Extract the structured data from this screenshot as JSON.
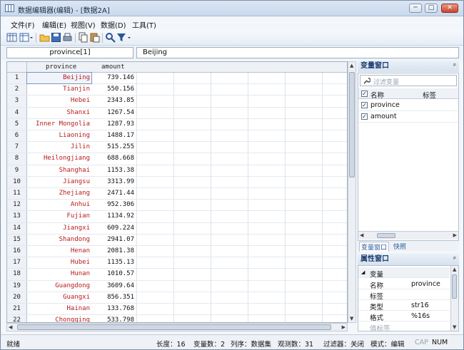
{
  "window": {
    "title": "数据编辑器(编辑) - [数据2A]",
    "min": "─",
    "max": "□",
    "close": "✕"
  },
  "menu": [
    "文件(F)",
    "编辑(E)",
    "视图(V)",
    "数据(D)",
    "工具(T)"
  ],
  "varbar": {
    "name": "province[1]",
    "value": "Beijing"
  },
  "grid": {
    "headers": [
      "province",
      "amount"
    ],
    "rows": [
      {
        "n": "1",
        "province": "Beijing",
        "amount": "739.146"
      },
      {
        "n": "2",
        "province": "Tianjin",
        "amount": "550.156"
      },
      {
        "n": "3",
        "province": "Hebei",
        "amount": "2343.85"
      },
      {
        "n": "4",
        "province": "Shanxi",
        "amount": "1267.54"
      },
      {
        "n": "5",
        "province": "Inner Mongolia",
        "amount": "1287.93"
      },
      {
        "n": "6",
        "province": "Liaoning",
        "amount": "1488.17"
      },
      {
        "n": "7",
        "province": "Jilin",
        "amount": "515.255"
      },
      {
        "n": "8",
        "province": "Heilongjiang",
        "amount": "688.668"
      },
      {
        "n": "9",
        "province": "Shanghai",
        "amount": "1153.38"
      },
      {
        "n": "10",
        "province": "Jiangsu",
        "amount": "3313.99"
      },
      {
        "n": "11",
        "province": "Zhejiang",
        "amount": "2471.44"
      },
      {
        "n": "12",
        "province": "Anhui",
        "amount": "952.306"
      },
      {
        "n": "13",
        "province": "Fujian",
        "amount": "1134.92"
      },
      {
        "n": "14",
        "province": "Jiangxi",
        "amount": "609.224"
      },
      {
        "n": "15",
        "province": "Shandong",
        "amount": "2941.07"
      },
      {
        "n": "16",
        "province": "Henan",
        "amount": "2081.38"
      },
      {
        "n": "17",
        "province": "Hubei",
        "amount": "1135.13"
      },
      {
        "n": "18",
        "province": "Hunan",
        "amount": "1010.57"
      },
      {
        "n": "19",
        "province": "Guangdong",
        "amount": "3609.64"
      },
      {
        "n": "20",
        "province": "Guangxi",
        "amount": "856.351"
      },
      {
        "n": "21",
        "province": "Hainan",
        "amount": "133.768"
      },
      {
        "n": "22",
        "province": "Chongqing",
        "amount": "533.798"
      }
    ]
  },
  "varwin": {
    "title": "变量窗口",
    "pin": "ᵖ",
    "filter_placeholder": "过滤变量",
    "col_name": "名称",
    "col_label": "标签",
    "vars": [
      "province",
      "amount"
    ]
  },
  "tabs": [
    "变量窗口",
    "快照"
  ],
  "propwin": {
    "title": "属性窗口",
    "group": "变量",
    "props": [
      {
        "k": "名称",
        "v": "province"
      },
      {
        "k": "标签",
        "v": ""
      },
      {
        "k": "类型",
        "v": "str16"
      },
      {
        "k": "格式",
        "v": "%16s"
      },
      {
        "k": "值标签",
        "v": ""
      }
    ]
  },
  "status": {
    "ready": "就绪",
    "length": "长度：16",
    "vars": "变量数：2",
    "order": "列序：数据集",
    "obs": "观测数：31",
    "filter": "过滤器：关闭",
    "mode": "模式：编辑",
    "cap": "CAP",
    "num": "NUM"
  },
  "colors": {
    "province_text": "#b71c1c",
    "panel_title": "#1b3e70"
  }
}
